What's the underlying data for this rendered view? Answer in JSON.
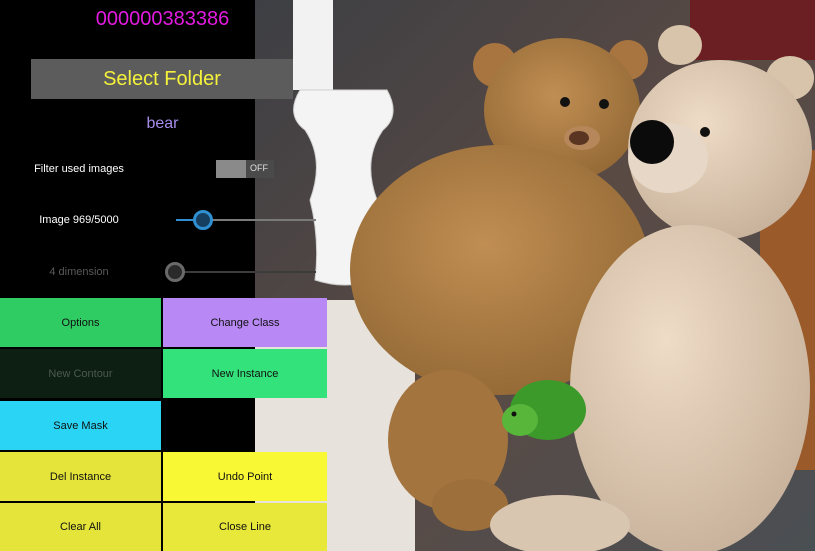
{
  "image_id": "000000383386",
  "select_folder_label": "Select Folder",
  "class_name": "bear",
  "filter": {
    "label": "Filter used images",
    "state": "OFF",
    "enabled": false
  },
  "image_slider": {
    "label": "Image 969/5000",
    "current": 969,
    "total": 5000,
    "fraction": 0.19
  },
  "dimension_slider": {
    "label": "4 dimension",
    "fraction": 0.0,
    "disabled": true
  },
  "buttons": {
    "options": "Options",
    "change_class": "Change Class",
    "new_contour": "New Contour",
    "new_instance": "New Instance",
    "save_mask": "Save Mask",
    "del_instance": "Del Instance",
    "undo_point": "Undo Point",
    "clear_all": "Clear All",
    "close_line": "Close Line"
  },
  "colors": {
    "id_magenta": "#e21be0",
    "title_yellow": "#f4f23a",
    "class_purple": "#a58ce8",
    "options_green": "#2ecc63",
    "change_class_purple": "#b889f4",
    "new_contour_dark": "#0d1e13",
    "new_instance_green": "#33e27a",
    "save_mask_cyan": "#2ad4f4",
    "yellow_btn": "#e4e43a",
    "undo_yellow": "#f8f835",
    "slider_blue": "#2f8fd0"
  }
}
